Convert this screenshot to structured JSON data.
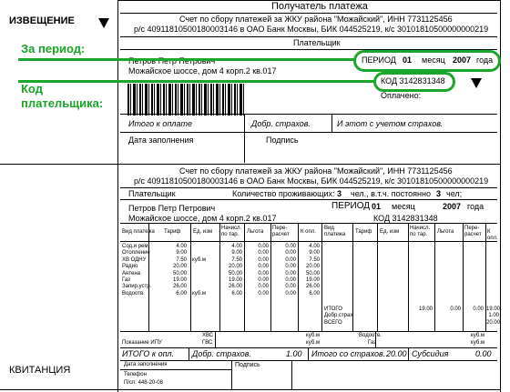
{
  "section_left": {
    "notice": "ИЗВЕЩЕНИЕ",
    "receipt": "КВИТАНЦИЯ"
  },
  "recipient_header": "Получатель платежа",
  "annotations": {
    "period": "За период:",
    "payer_code_line1": "Код",
    "payer_code_line2": "плательщика:"
  },
  "top": {
    "invoice_title": "Счет по сбору платежей за ЖКУ района \"Можайский\", ИНН 7731125456",
    "bank_details": "р/с 40911810500180003146 в ОАО Банк Москвы, БИК 044525219, к/с 30101810500000000219",
    "payer_label": "Плательщик",
    "payer_name": "Петров Петр Петрович",
    "payer_address": "Можайское шоссе, дом 4 корп.2 кв.017",
    "period_label": "ПЕРИОД",
    "period_month": "01",
    "month_label": "месяц",
    "period_year": "2007",
    "year_label": "года",
    "code": "КОД 3142831348",
    "paid_label": "Оплачено:",
    "total_label": "Итого к оплате",
    "insurance_label": "Добр. страхов.",
    "with_insurance_label": "И этот с учетом страхов.",
    "fill_date_label": "Дата заполнения",
    "signature_label": "Подпись"
  },
  "bottom": {
    "invoice_title": "Счет по сбору платежей за ЖКУ района \"Можайский\", ИНН 7731125456",
    "bank_details": "р/с 40911810500180003146 в ОАО Банк Москвы, БИК 044525219, к/с 30101810500000000219",
    "payer_label": "Плательщик",
    "residents_label": "Количество проживающих:",
    "residents_value": "3",
    "persons_label": "чел., в.т.ч. постоянно",
    "permanent_value": "3",
    "persons_end": "чел;",
    "payer_name": "Петров Петр Петрович",
    "payer_address": "Можайское шоссе, дом 4 корп.2 кв.017",
    "period_label": "ПЕРИОД",
    "period_month": "01",
    "month_label": "месяц",
    "period_year": "2007",
    "year_label": "года",
    "code": "КОД 3142831348",
    "table_headers": [
      "Вид платежа",
      "Тариф",
      "Ед. изм",
      "Начисл. по тар.",
      "Льгота",
      "Пере-расчет",
      "К опл."
    ],
    "table_headers_right": [
      "Вид платежа",
      "Тариф",
      "Ед. изм",
      "Начисл. по тар.",
      "Льгота",
      "Пере-расчет",
      "К опл."
    ],
    "services": "Сод.и рем.\nОтопление\nХВ ОДНУ\nРадио\nАнтена\nГаз\nЗапир.устр.\nВодоотв.",
    "tariffs": "4.00\n9.00\n7.50\n20.00\n50.00\n19.00\n26.00\n6.00",
    "units": "\n\nкуб.м\n\n\n\n\nкуб.м",
    "charged": "4.00\n9.00\n7.50\n20.00\n50.00\n19.00\n26.00\n6.00",
    "benefits": "0.00\n0.00\n0.00\n0.00\n0.00\n0.00\n0.00\n0.00",
    "recalc": "0.00\n0.00\n0.00\n0.00\n0.00\n0.00\n0.00\n0.00",
    "to_pay": "4.00\n9.00\n7.50\n20.00\n50.00\n19.00\n26.00\n6.00",
    "totals_labels": "ИТОГО\nДобр.страх\nВСЕГО",
    "totals_charged": "19.00",
    "totals_benefit": "0.00",
    "totals_recalc": "0.00",
    "totals_pay": "19.00\n1.00\n20.00",
    "meter_label": "Показание ИПУ",
    "hvs": "ХВС",
    "gvs": "ГВС",
    "cubm1": "куб.м",
    "cubm2": "куб.м",
    "drain": "Водоотв.",
    "gas": "Газ",
    "cubm3": "куб.м",
    "cubm4": "куб.м",
    "total_pay_label": "ИТОГО к опл.",
    "insurance_label": "Добр. страхов.",
    "insurance_value": "1.00",
    "total_with_insurance_label": "Итого со страхов.",
    "total_with_insurance_value": "20.00",
    "subsidy_label": "Субсидия",
    "subsidy_value": "0.00",
    "fill_date_label": "Дата заполнения",
    "signature_label": "Подпись",
    "phone_label": "Телефон",
    "phone_value": "П/сп: 448-20-08"
  },
  "colors": {
    "annotation_green": "#1aa52b"
  },
  "icons": {
    "arrow1": "triangle-down",
    "arrow2": "triangle-down"
  }
}
